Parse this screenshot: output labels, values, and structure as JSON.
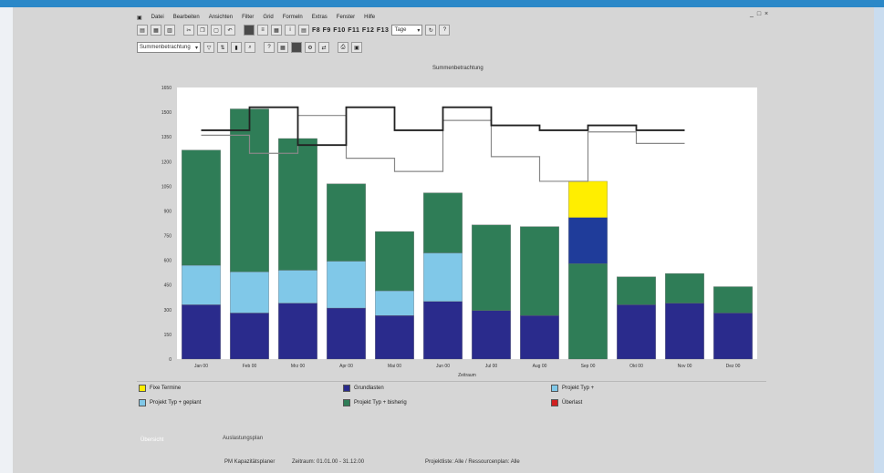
{
  "menu": [
    "Datei",
    "Bearbeiten",
    "Ansichten",
    "Filter",
    "Grid",
    "Formeln",
    "Extras",
    "Fenster",
    "Hilfe"
  ],
  "window_controls": "_ □ ×",
  "toolbar": {
    "fkeys_label": "F8 F9 F10 F11 F12 F13",
    "period_combo": "Tage",
    "view_combo": "Summenbetrachtung"
  },
  "chart_data": {
    "type": "bar",
    "title": "Summenbetrachtung",
    "categories": [
      "Jan 00",
      "Feb 00",
      "Mrz 00",
      "Apr 00",
      "Mai 00",
      "Jun 00",
      "Jul 00",
      "Aug 00",
      "Sep 00",
      "Okt 00",
      "Nov 00",
      "Dez 00"
    ],
    "xlabel": "Zeitraum",
    "ylabel": "",
    "ylim": [
      0,
      1650
    ],
    "yticks": [
      "0",
      "150",
      "300",
      "450",
      "600",
      "750",
      "900",
      "1050",
      "1200",
      "1350",
      "1500",
      "1650"
    ],
    "series": [
      {
        "name": "Grundlasten",
        "color": "#2a2b8c",
        "values": [
          330,
          280,
          340,
          310,
          265,
          350,
          295,
          265,
          0,
          330,
          340,
          280
        ]
      },
      {
        "name": "Projekt Typ + geplant",
        "color": "#80c8e8",
        "values": [
          240,
          250,
          200,
          285,
          150,
          295,
          0,
          0,
          0,
          0,
          0,
          0
        ]
      },
      {
        "name": "Projekt Typ + bisherig",
        "color": "#2f7d57",
        "values": [
          700,
          990,
          800,
          470,
          360,
          365,
          520,
          540,
          580,
          170,
          180,
          160
        ]
      },
      {
        "name": "Projekt Typ +",
        "color": "#1f3c9a",
        "values": [
          0,
          0,
          0,
          0,
          0,
          0,
          0,
          0,
          280,
          0,
          0,
          0
        ]
      },
      {
        "name": "Fixe Termine",
        "color": "#ffee00",
        "values": [
          0,
          0,
          0,
          0,
          0,
          0,
          0,
          0,
          220,
          0,
          0,
          0
        ]
      }
    ],
    "capacity_lines": [
      {
        "name": "Kapazität dunkel",
        "values": [
          1390,
          1530,
          1300,
          1530,
          1390,
          1530,
          1420,
          1390,
          1420,
          1390
        ]
      },
      {
        "name": "Kapazität hell",
        "values": [
          1360,
          1250,
          1480,
          1220,
          1140,
          1450,
          1230,
          1080,
          1380,
          1310
        ]
      }
    ]
  },
  "legend": [
    {
      "label": "Fixe Termine",
      "color": "#ffee00"
    },
    {
      "label": "Grundlasten",
      "color": "#2a2b8c"
    },
    {
      "label": "Projekt Typ +",
      "color": "#80c8e8"
    },
    {
      "label": "Projekt Typ + geplant",
      "color": "#80c8e8"
    },
    {
      "label": "Projekt Typ + bisherig",
      "color": "#2f7d57"
    },
    {
      "label": "Überlast",
      "color": "#d02020"
    }
  ],
  "status": {
    "tab": "Übersicht",
    "info": "Auslastungsplan",
    "line1": "PM Kapazitätsplaner",
    "line2": "Zeitraum: 01.01.00 - 31.12.00",
    "line3": "Projektliste: Alle / Ressourcenplan: Alle"
  }
}
